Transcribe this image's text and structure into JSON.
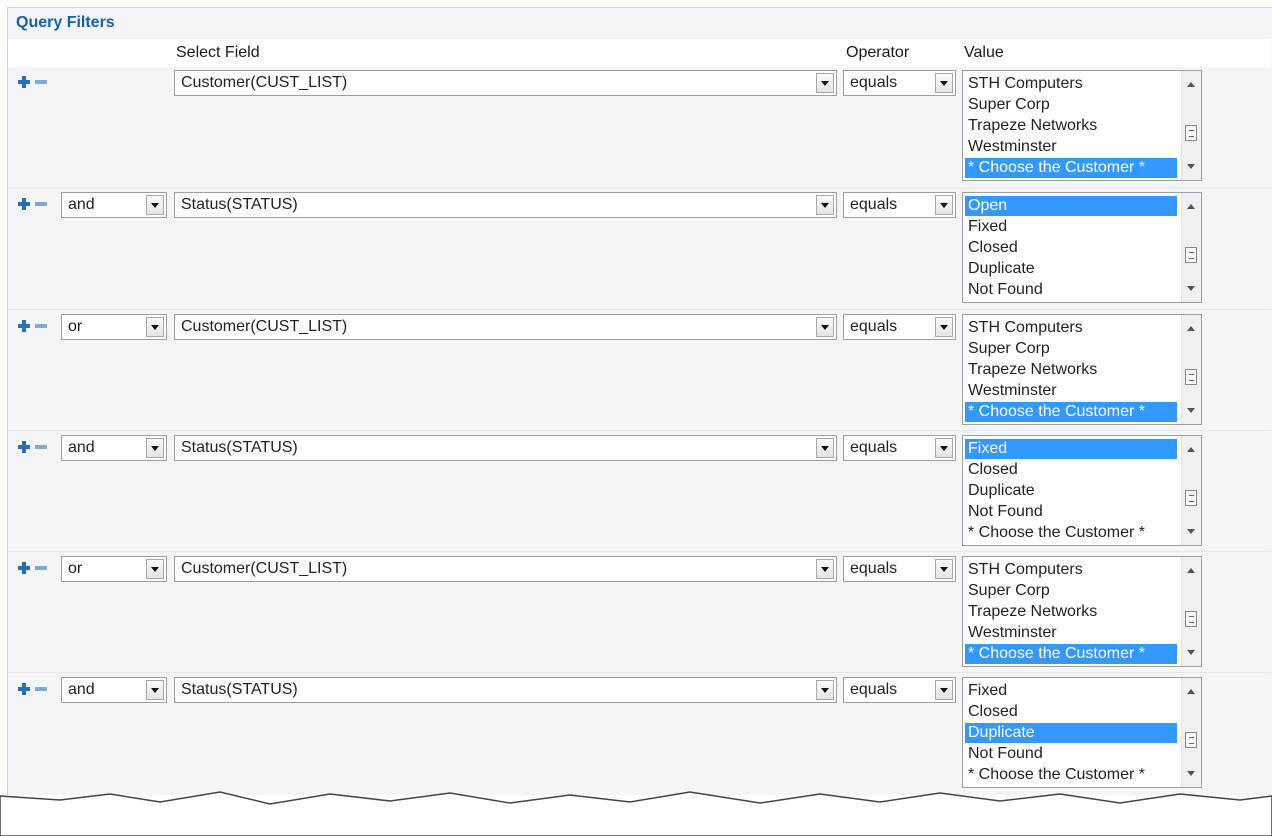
{
  "panel": {
    "title": "Query Filters"
  },
  "headers": {
    "field": "Select Field",
    "operator": "Operator",
    "value": "Value"
  },
  "rows": [
    {
      "logic": null,
      "field": "Customer(CUST_LIST)",
      "operator": "equals",
      "options": [
        "STH Computers",
        "Super Corp",
        "Trapeze Networks",
        "Westminster",
        "* Choose the Customer *"
      ],
      "selected": 4
    },
    {
      "logic": "and",
      "field": "Status(STATUS)",
      "operator": "equals",
      "options": [
        "Open",
        "Fixed",
        "Closed",
        "Duplicate",
        "Not Found"
      ],
      "selected": 0
    },
    {
      "logic": "or",
      "field": "Customer(CUST_LIST)",
      "operator": "equals",
      "options": [
        "STH Computers",
        "Super Corp",
        "Trapeze Networks",
        "Westminster",
        "* Choose the Customer *"
      ],
      "selected": 4
    },
    {
      "logic": "and",
      "field": "Status(STATUS)",
      "operator": "equals",
      "options": [
        "Fixed",
        "Closed",
        "Duplicate",
        "Not Found",
        "* Choose the Customer *"
      ],
      "selected": 0
    },
    {
      "logic": "or",
      "field": "Customer(CUST_LIST)",
      "operator": "equals",
      "options": [
        "STH Computers",
        "Super Corp",
        "Trapeze Networks",
        "Westminster",
        "* Choose the Customer *"
      ],
      "selected": 4
    },
    {
      "logic": "and",
      "field": "Status(STATUS)",
      "operator": "equals",
      "options": [
        "Fixed",
        "Closed",
        "Duplicate",
        "Not Found",
        "* Choose the Customer *"
      ],
      "selected": 2
    }
  ],
  "icons": {
    "add": "plus-icon",
    "remove": "minus-icon",
    "dropdown": "dropdown-arrow-icon"
  },
  "colors": {
    "title": "#1a5fa8",
    "selection": "#3399ff",
    "icon": "#2d6fb6"
  }
}
